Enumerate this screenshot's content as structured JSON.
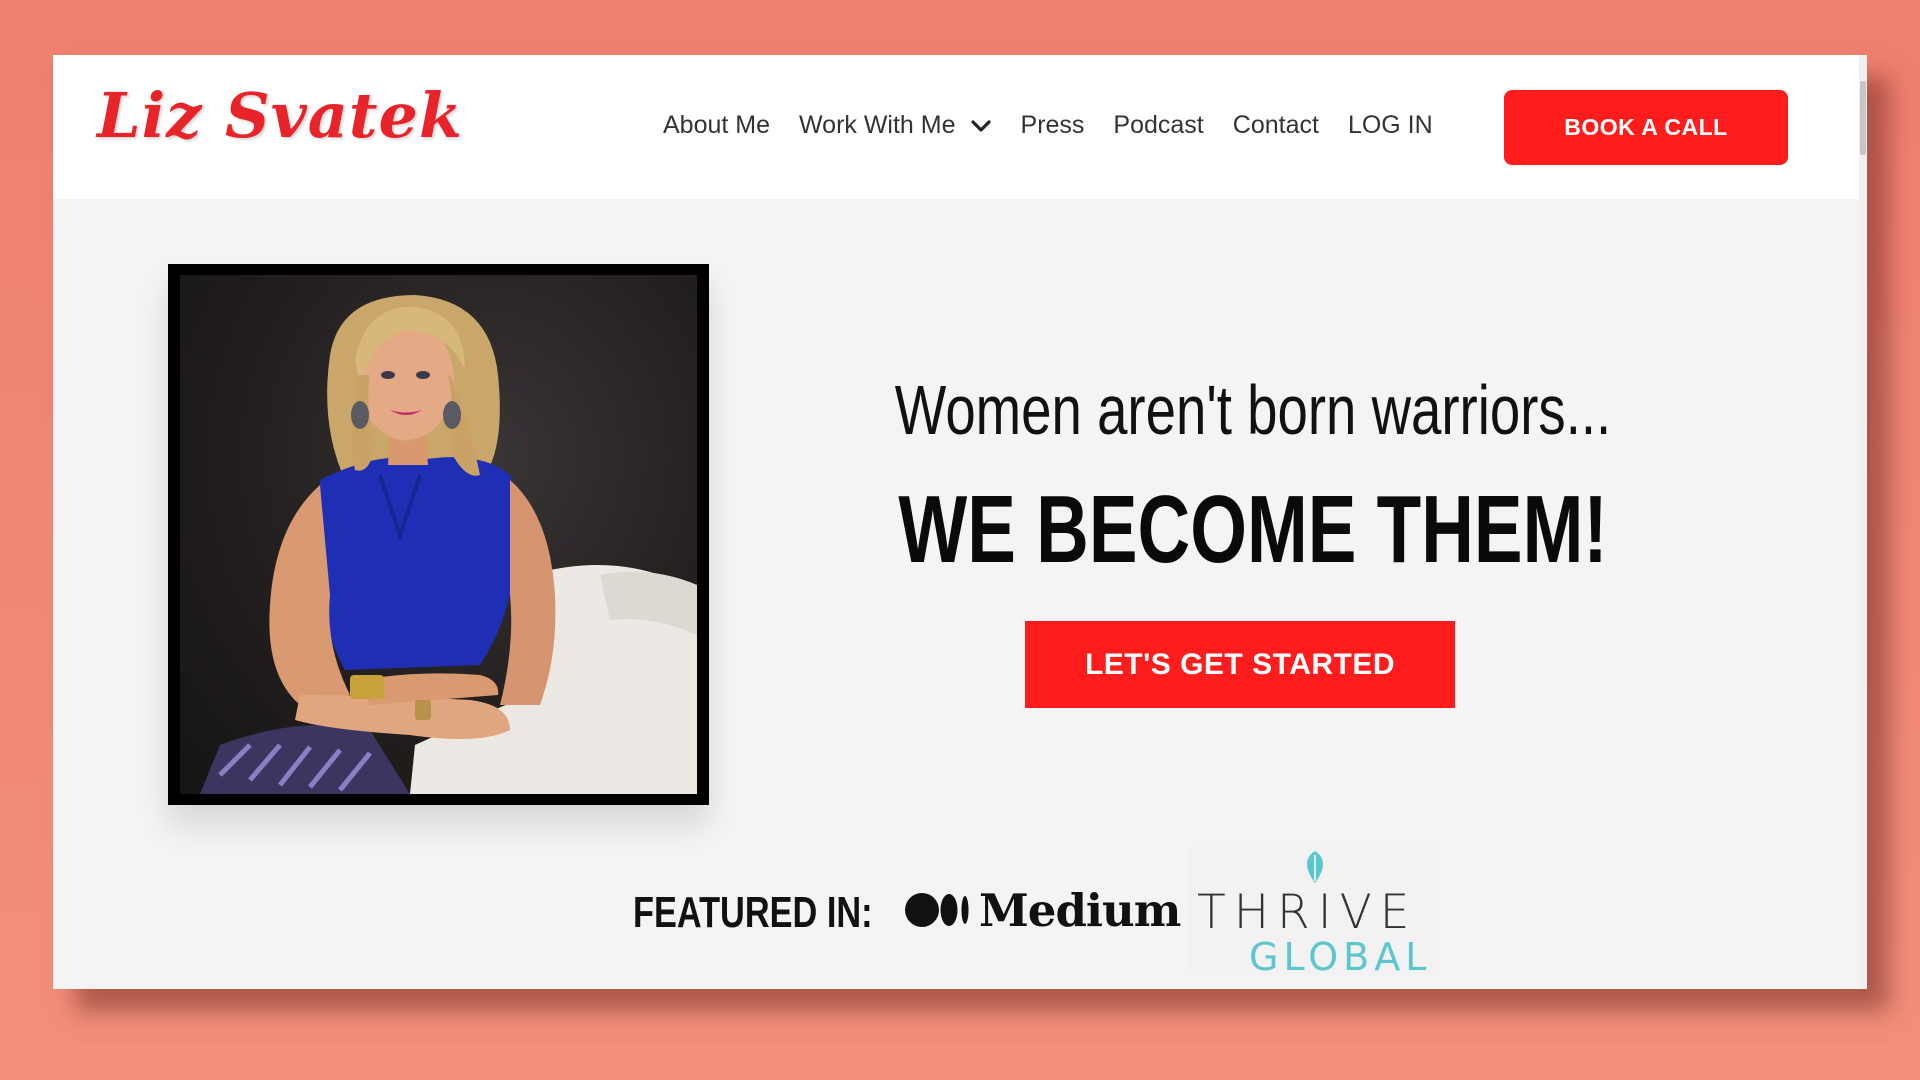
{
  "brand": {
    "name": "Liz Svatek",
    "color": "#e8242a"
  },
  "nav": {
    "items": [
      {
        "label": "About Me"
      },
      {
        "label": "Work With Me",
        "has_dropdown": true
      },
      {
        "label": "Press"
      },
      {
        "label": "Podcast"
      },
      {
        "label": "Contact"
      },
      {
        "label": "LOG IN"
      }
    ],
    "cta_label": "BOOK A CALL"
  },
  "hero": {
    "headline_1": "Women aren't born warriors...",
    "headline_2": "WE BECOME THEM!",
    "cta_label": "LET'S GET STARTED"
  },
  "featured": {
    "label": "FEATURED IN:",
    "logos": [
      {
        "name": "Medium",
        "text": "Medium"
      },
      {
        "name": "Thrive Global",
        "text_1": "THRIVE",
        "text_2": "GLOBAL"
      }
    ]
  },
  "colors": {
    "accent": "#ff1c1c",
    "background": "#f4f4f4",
    "outer_background": "#ef7f6f",
    "thrive_teal": "#5cc6cf"
  }
}
